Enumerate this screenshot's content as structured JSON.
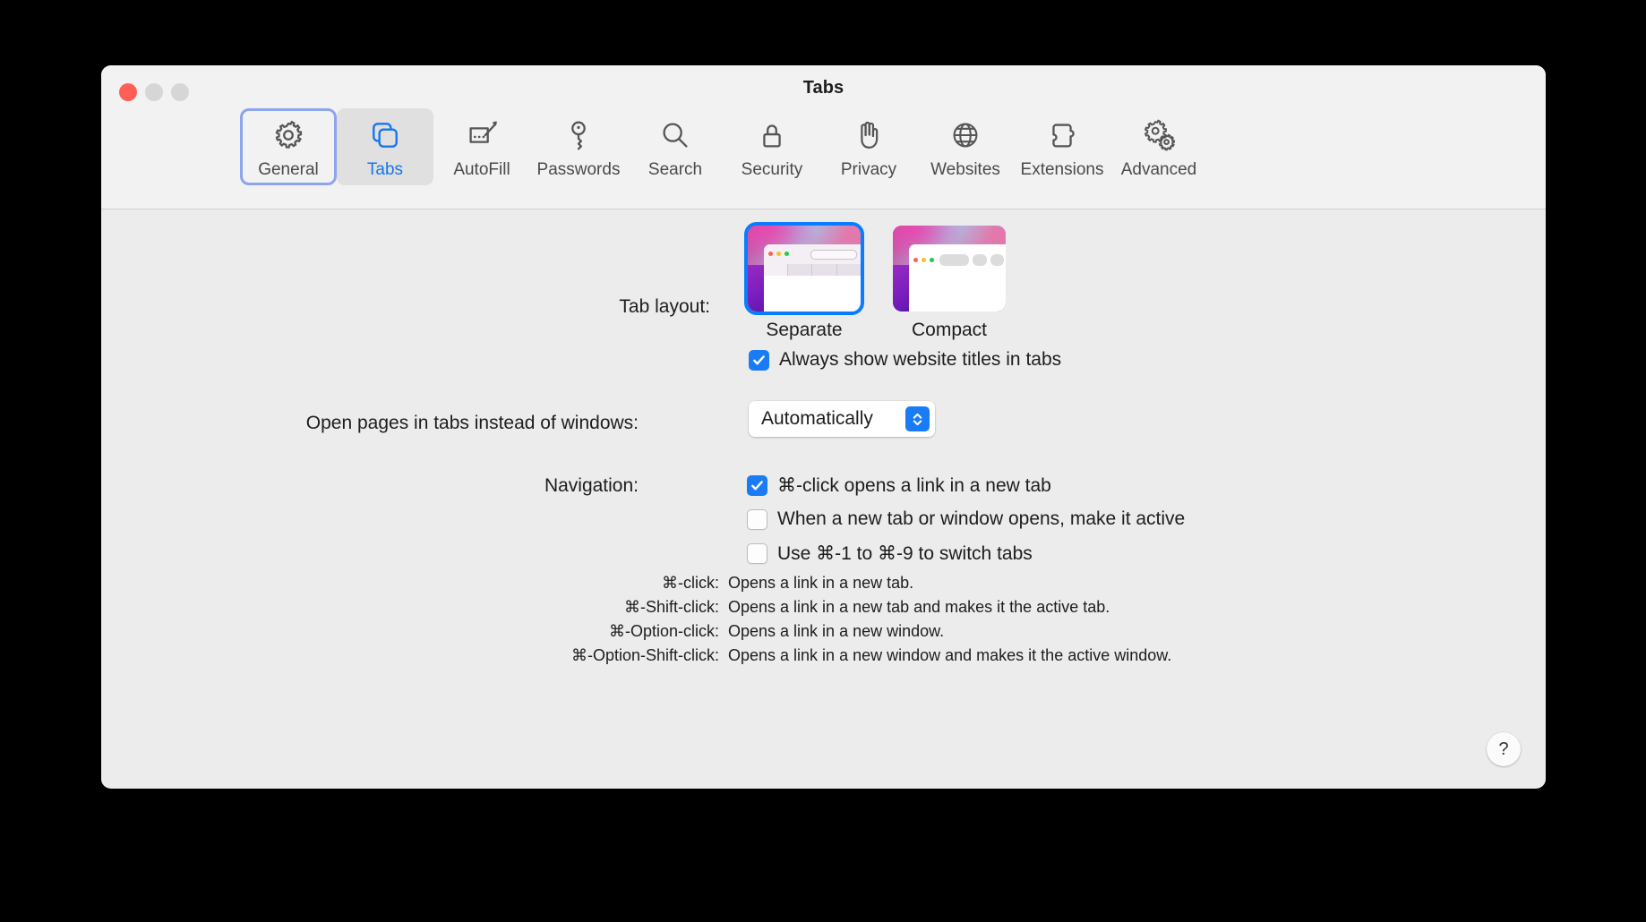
{
  "window": {
    "title": "Tabs",
    "traffic_lights": [
      "close",
      "minimize",
      "zoom"
    ]
  },
  "toolbar": {
    "items": [
      {
        "label": "General",
        "icon": "gear-icon",
        "selected": false,
        "focused": true
      },
      {
        "label": "Tabs",
        "icon": "tabs-icon",
        "selected": true,
        "focused": false
      },
      {
        "label": "AutoFill",
        "icon": "autofill-icon",
        "selected": false,
        "focused": false
      },
      {
        "label": "Passwords",
        "icon": "key-icon",
        "selected": false,
        "focused": false
      },
      {
        "label": "Search",
        "icon": "search-icon",
        "selected": false,
        "focused": false
      },
      {
        "label": "Security",
        "icon": "lock-icon",
        "selected": false,
        "focused": false
      },
      {
        "label": "Privacy",
        "icon": "hand-icon",
        "selected": false,
        "focused": false
      },
      {
        "label": "Websites",
        "icon": "globe-icon",
        "selected": false,
        "focused": false
      },
      {
        "label": "Extensions",
        "icon": "puzzle-icon",
        "selected": false,
        "focused": false
      },
      {
        "label": "Advanced",
        "icon": "double-gear-icon",
        "selected": false,
        "focused": false
      }
    ]
  },
  "tab_layout": {
    "label": "Tab layout:",
    "options": [
      {
        "caption": "Separate",
        "selected": true
      },
      {
        "caption": "Compact",
        "selected": false
      }
    ]
  },
  "website_titles": {
    "label": "Always show website titles in tabs",
    "checked": true
  },
  "open_pages": {
    "label": "Open pages in tabs instead of windows:",
    "value": "Automatically"
  },
  "navigation": {
    "label": "Navigation:",
    "options": [
      {
        "label": "⌘-click opens a link in a new tab",
        "checked": true
      },
      {
        "label": "When a new tab or window opens, make it active",
        "checked": false
      },
      {
        "label": "Use ⌘-1 to ⌘-9 to switch tabs",
        "checked": false
      }
    ]
  },
  "shortcuts": [
    {
      "key": "⌘-click:",
      "desc": "Opens a link in a new tab."
    },
    {
      "key": "⌘-Shift-click:",
      "desc": "Opens a link in a new tab and makes it the active tab."
    },
    {
      "key": "⌘-Option-click:",
      "desc": "Opens a link in a new window."
    },
    {
      "key": "⌘-Option-Shift-click:",
      "desc": "Opens a link in a new window and makes it the active window."
    }
  ],
  "help_button": {
    "label": "?"
  },
  "colors": {
    "accent_blue": "#1a7cf5",
    "selection_blue": "#0a7cff",
    "focus_ring": "#8da4ee",
    "window_bg": "#ececec",
    "titlebar_bg": "#f2f2f2"
  }
}
